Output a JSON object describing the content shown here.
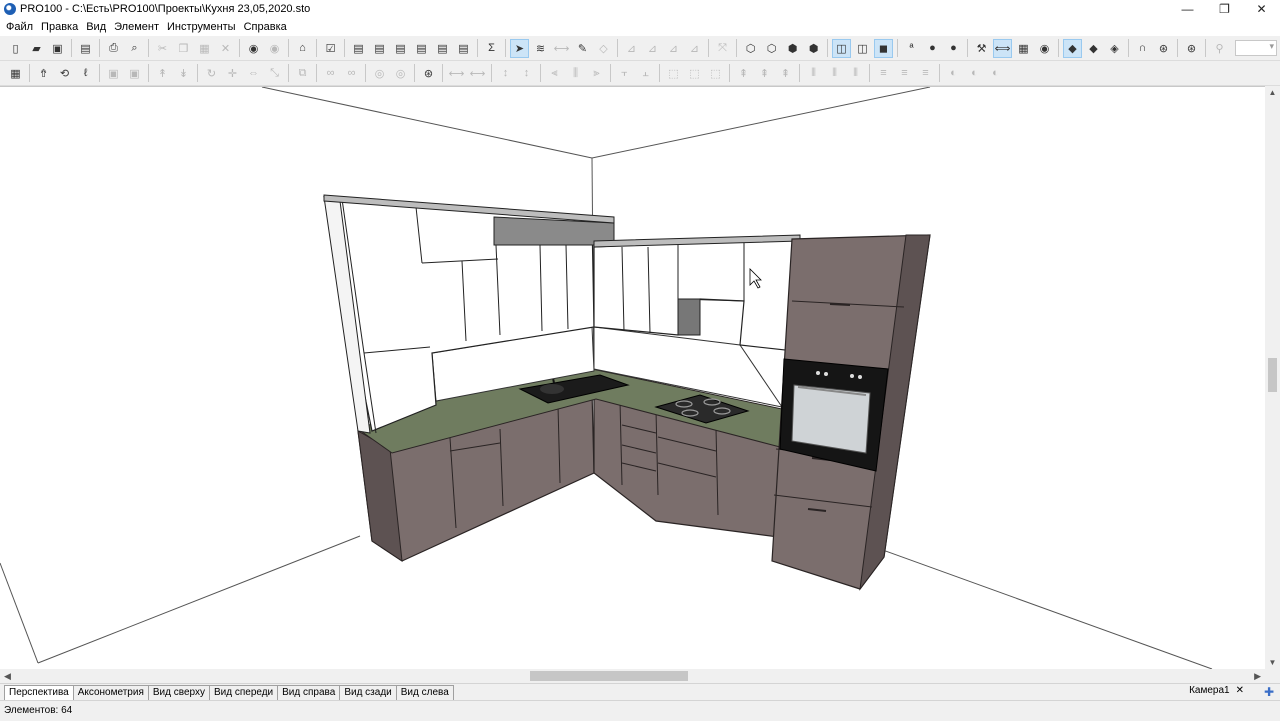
{
  "window": {
    "title": "PRO100 - C:\\Есть\\PRO100\\Проекты\\Кухня 23,05,2020.sto",
    "controls": {
      "minimize": "—",
      "restore": "❐",
      "close": "✕"
    }
  },
  "menu": [
    "Файл",
    "Правка",
    "Вид",
    "Элемент",
    "Инструменты",
    "Справка"
  ],
  "toolbar1": [
    {
      "name": "new-file-icon",
      "glyph": "▯"
    },
    {
      "name": "open-folder-icon",
      "glyph": "▰"
    },
    {
      "name": "save-icon",
      "glyph": "▣"
    },
    "|",
    {
      "name": "properties-icon",
      "glyph": "▤"
    },
    "|",
    {
      "name": "print-icon",
      "glyph": "⎙"
    },
    {
      "name": "print-preview-icon",
      "glyph": "⌕"
    },
    "|",
    {
      "name": "cut-icon",
      "glyph": "✂",
      "dim": true
    },
    {
      "name": "copy-icon",
      "glyph": "❐",
      "dim": true
    },
    {
      "name": "paste-icon",
      "glyph": "▦",
      "dim": true
    },
    {
      "name": "delete-icon",
      "glyph": "✕",
      "dim": true
    },
    "|",
    {
      "name": "undo-icon",
      "glyph": "◉"
    },
    {
      "name": "redo-icon",
      "glyph": "◉",
      "dim": true
    },
    "|",
    {
      "name": "library-icon",
      "glyph": "⌂"
    },
    "|",
    {
      "name": "checklist-icon",
      "glyph": "☑"
    },
    "|",
    {
      "name": "report-icon",
      "glyph": "▤"
    },
    {
      "name": "report-preview-icon",
      "glyph": "▤"
    },
    {
      "name": "report-export-icon",
      "glyph": "▤"
    },
    {
      "name": "report-print-icon",
      "glyph": "▤"
    },
    {
      "name": "report-download-icon",
      "glyph": "▤"
    },
    {
      "name": "report-settings-icon",
      "glyph": "▤"
    },
    "|",
    {
      "name": "sum-icon",
      "glyph": "Σ"
    },
    "|",
    {
      "name": "select-pointer-icon",
      "glyph": "➤",
      "on": true
    },
    {
      "name": "move-icon",
      "glyph": "≋"
    },
    {
      "name": "measure-icon",
      "glyph": "⟷",
      "dim": true
    },
    {
      "name": "eyedropper-icon",
      "glyph": "✎"
    },
    {
      "name": "eraser-icon",
      "glyph": "◇",
      "dim": true
    },
    "|",
    {
      "name": "dim-tool-1-icon",
      "glyph": "⊿",
      "dim": true
    },
    {
      "name": "dim-tool-2-icon",
      "glyph": "⊿",
      "dim": true
    },
    {
      "name": "dim-tool-3-icon",
      "glyph": "⊿",
      "dim": true
    },
    {
      "name": "dim-tool-4-icon",
      "glyph": "⊿",
      "dim": true
    },
    "|",
    {
      "name": "zoom-fit-icon",
      "glyph": "⤧",
      "dim": true
    },
    "|",
    {
      "name": "view-wire-icon",
      "glyph": "⬡"
    },
    {
      "name": "view-hidden-icon",
      "glyph": "⬡"
    },
    {
      "name": "view-shaded-icon",
      "glyph": "⬢"
    },
    {
      "name": "view-textured-icon",
      "glyph": "⬢"
    },
    "|",
    {
      "name": "wall-left-icon",
      "glyph": "◫",
      "on": true
    },
    {
      "name": "wall-right-icon",
      "glyph": "◫"
    },
    {
      "name": "floor-icon",
      "glyph": "◼",
      "on": true
    },
    "|",
    {
      "name": "text-label-icon",
      "glyph": "ª"
    },
    {
      "name": "material-icon",
      "glyph": "●"
    },
    {
      "name": "light-bulb-icon",
      "glyph": "●"
    },
    "|",
    {
      "name": "handles-icon",
      "glyph": "⚒"
    },
    {
      "name": "dimensions-icon",
      "glyph": "⟺",
      "on": true
    },
    {
      "name": "grid-icon",
      "glyph": "▦"
    },
    {
      "name": "eye-icon",
      "glyph": "◉"
    },
    "|",
    {
      "name": "snap-1-icon",
      "glyph": "◆",
      "on": true
    },
    {
      "name": "snap-2-icon",
      "glyph": "◆"
    },
    {
      "name": "snap-3-icon",
      "glyph": "◈"
    },
    "|",
    {
      "name": "magnet-icon",
      "glyph": "∩"
    },
    {
      "name": "target-icon",
      "glyph": "⊛"
    },
    "|",
    {
      "name": "render-icon",
      "glyph": "⊛"
    },
    "|",
    {
      "name": "zoom-icon",
      "glyph": "⚲",
      "dim": true
    }
  ],
  "toolbar2": [
    {
      "name": "grid-snap-icon",
      "glyph": "▦"
    },
    "|",
    {
      "name": "raise-icon",
      "glyph": "⇮"
    },
    {
      "name": "rotate-3d-icon",
      "glyph": "⟲"
    },
    {
      "name": "edit-shape-icon",
      "glyph": "ℓ"
    },
    "|",
    {
      "name": "group-icon",
      "glyph": "▣",
      "dim": true
    },
    {
      "name": "ungroup-icon",
      "glyph": "▣",
      "dim": true
    },
    "|",
    {
      "name": "align-up-icon",
      "glyph": "↟",
      "dim": true
    },
    {
      "name": "align-down-icon",
      "glyph": "↡",
      "dim": true
    },
    "|",
    {
      "name": "rotate-icon",
      "glyph": "↻",
      "dim": true
    },
    {
      "name": "move-cross-icon",
      "glyph": "✛",
      "dim": true
    },
    {
      "name": "mirror-icon",
      "glyph": "⇔",
      "dim": true
    },
    {
      "name": "resize-icon",
      "glyph": "⤡",
      "dim": true
    },
    "|",
    {
      "name": "array-icon",
      "glyph": "⧉",
      "dim": true
    },
    "|",
    {
      "name": "link-1-icon",
      "glyph": "∞",
      "dim": true
    },
    {
      "name": "link-2-icon",
      "glyph": "∞",
      "dim": true
    },
    "|",
    {
      "name": "view-1-icon",
      "glyph": "◎",
      "dim": true
    },
    {
      "name": "view-2-icon",
      "glyph": "◎",
      "dim": true
    },
    "|",
    {
      "name": "stop-icon",
      "glyph": "⊛"
    },
    "|",
    {
      "name": "width-icon",
      "glyph": "⟷",
      "dim": true
    },
    {
      "name": "width-2-icon",
      "glyph": "⟷",
      "dim": true
    },
    "|",
    {
      "name": "height-icon",
      "glyph": "↕",
      "dim": true
    },
    {
      "name": "height-2-icon",
      "glyph": "↕",
      "dim": true
    },
    "|",
    {
      "name": "align-left-icon",
      "glyph": "⫷",
      "dim": true
    },
    {
      "name": "align-center-icon",
      "glyph": "⫼",
      "dim": true
    },
    {
      "name": "align-right-icon",
      "glyph": "⫸",
      "dim": true
    },
    "|",
    {
      "name": "align-top-icon",
      "glyph": "⫟",
      "dim": true
    },
    {
      "name": "align-middle-icon",
      "glyph": "⫠",
      "dim": true
    },
    "|",
    {
      "name": "distribute-1-icon",
      "glyph": "⬚",
      "dim": true
    },
    {
      "name": "distribute-2-icon",
      "glyph": "⬚",
      "dim": true
    },
    {
      "name": "distribute-3-icon",
      "glyph": "⬚",
      "dim": true
    },
    "|",
    {
      "name": "depth-1-icon",
      "glyph": "⇞",
      "dim": true
    },
    {
      "name": "depth-2-icon",
      "glyph": "⇞",
      "dim": true
    },
    {
      "name": "depth-3-icon",
      "glyph": "⇞",
      "dim": true
    },
    "|",
    {
      "name": "space-1-icon",
      "glyph": "⫴",
      "dim": true
    },
    {
      "name": "space-2-icon",
      "glyph": "⫴",
      "dim": true
    },
    {
      "name": "space-3-icon",
      "glyph": "⫴",
      "dim": true
    },
    "|",
    {
      "name": "order-1-icon",
      "glyph": "≡",
      "dim": true
    },
    {
      "name": "order-2-icon",
      "glyph": "≡",
      "dim": true
    },
    {
      "name": "order-3-icon",
      "glyph": "≡",
      "dim": true
    },
    "|",
    {
      "name": "fill-1-icon",
      "glyph": "◐",
      "dim": true
    },
    {
      "name": "fill-2-icon",
      "glyph": "◐",
      "dim": true
    },
    {
      "name": "fill-3-icon",
      "glyph": "◐",
      "dim": true
    }
  ],
  "view_tabs": [
    "Перспектива",
    "Аксонометрия",
    "Вид сверху",
    "Вид спереди",
    "Вид справа",
    "Вид сзади",
    "Вид слева"
  ],
  "active_view_tab": 0,
  "camera_tab": "Камера1",
  "status": "Элементов: 64",
  "colors": {
    "cabinet_wood": "#7b6e6d",
    "cabinet_wood_dark": "#5d5252",
    "countertop": "#6f7c5f",
    "wall_cabinet": "#ffffff",
    "selection_blue": "#cce4f7"
  }
}
